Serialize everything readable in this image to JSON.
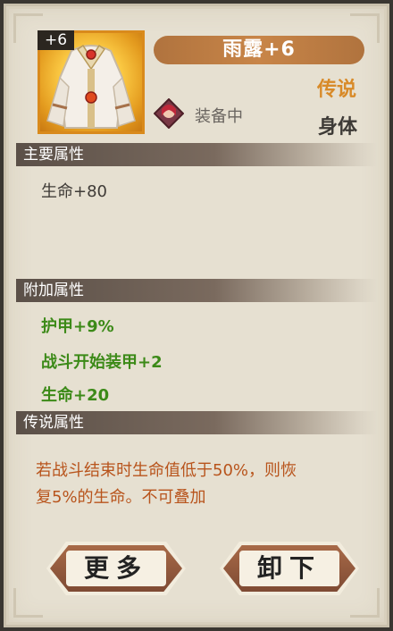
{
  "item": {
    "level_badge": "+6",
    "name": "雨露+6",
    "rarity": "传说",
    "slot": "身体",
    "equipped_label": "装备中"
  },
  "sections": {
    "main": {
      "title": "主要属性",
      "stats": [
        "生命+80"
      ]
    },
    "extra": {
      "title": "附加属性",
      "stats": [
        "护甲+9%",
        "战斗开始装甲+2",
        "生命+20"
      ]
    },
    "legend": {
      "title": "传说属性",
      "text_line1": "若战斗结束时生命值低于50%，则恢",
      "text_line2": "复5%的生命。不可叠加"
    }
  },
  "buttons": {
    "more": "更多",
    "unequip": "卸下"
  },
  "colors": {
    "rarity": "#d88a28",
    "stat_green": "#3c8a18",
    "legend_text": "#b8541c",
    "title_bar": "#c88548"
  },
  "icons": {
    "item": "white-robe-armor-icon",
    "equipped_hero": "hero-portrait-icon"
  }
}
